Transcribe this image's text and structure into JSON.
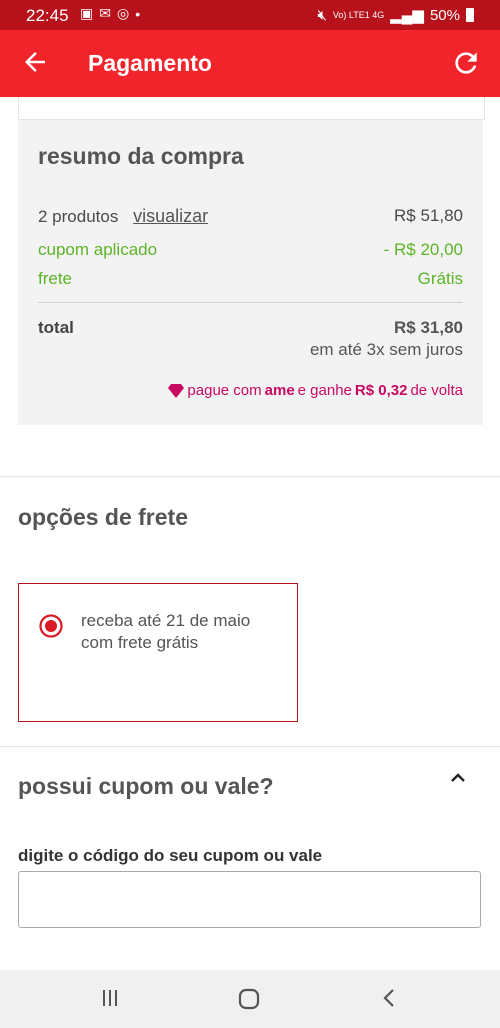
{
  "status_bar": {
    "time": "22:45",
    "notification_icons": [
      "message-icon",
      "mail-icon",
      "whatsapp-icon",
      "dot-icon"
    ],
    "network": "Vo) LTE1 4G",
    "battery": "50%"
  },
  "app_bar": {
    "title": "Pagamento",
    "back_icon": "arrow-left-icon",
    "refresh_icon": "refresh-icon"
  },
  "summary": {
    "title": "resumo da compra",
    "products_label": "2 produtos",
    "view_link": "visualizar",
    "products_value": "R$ 51,80",
    "coupon_label": "cupom aplicado",
    "coupon_value": "- R$ 20,00",
    "shipping_label": "frete",
    "shipping_value": "Grátis",
    "total_label": "total",
    "total_value": "R$ 31,80",
    "installments": "em até 3x sem juros",
    "ame_prefix": "pague com",
    "ame_brand": "ame",
    "ame_middle": "e ganhe",
    "ame_amount": "R$ 0,32",
    "ame_suffix": "de volta"
  },
  "shipping_options": {
    "title": "opções de frete",
    "option_line1": "receba até 21 de maio",
    "option_line2": "com frete grátis",
    "selected": true
  },
  "coupon": {
    "title": "possui cupom ou vale?",
    "field_label": "digite o código do seu cupom ou vale",
    "field_value": "",
    "field_placeholder": ""
  },
  "colors": {
    "status_bar": "#b7121b",
    "app_bar": "#f2242b",
    "accent": "#d81b26",
    "green": "#5cb528",
    "ame": "#c80a63"
  }
}
